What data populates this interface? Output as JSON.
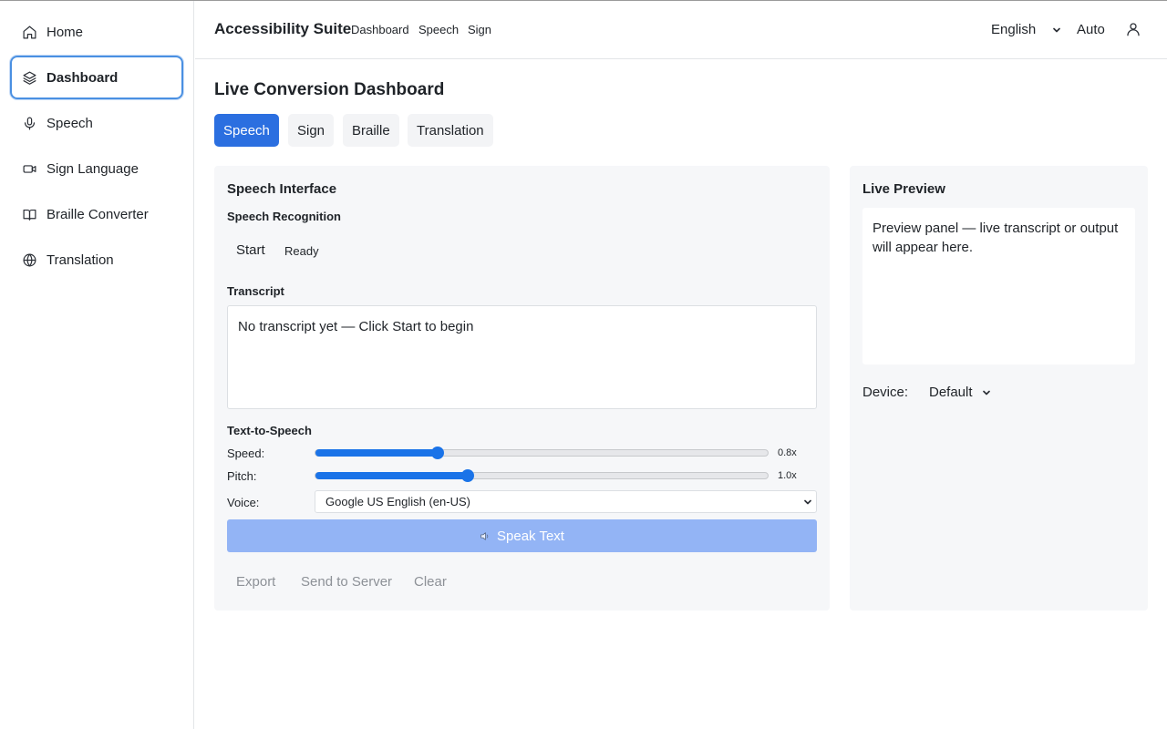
{
  "sidebar": {
    "items": [
      {
        "label": "Home",
        "icon": "home-icon"
      },
      {
        "label": "Dashboard",
        "icon": "layers-icon",
        "active": true
      },
      {
        "label": "Speech",
        "icon": "microphone-icon"
      },
      {
        "label": "Sign Language",
        "icon": "video-camera-icon"
      },
      {
        "label": "Braille Converter",
        "icon": "book-icon"
      },
      {
        "label": "Translation",
        "icon": "globe-icon"
      }
    ]
  },
  "header": {
    "brand": "Accessibility Suite",
    "nav": [
      "Dashboard",
      "Speech",
      "Sign"
    ],
    "language": "English",
    "mode": "Auto",
    "user_icon": "user-icon"
  },
  "main": {
    "title": "Live Conversion Dashboard",
    "tabs": [
      {
        "label": "Speech",
        "active": true
      },
      {
        "label": "Sign"
      },
      {
        "label": "Braille"
      },
      {
        "label": "Translation"
      }
    ],
    "speech_panel": {
      "title": "Speech Interface",
      "recognition_title": "Speech Recognition",
      "start_label": "Start",
      "status": "Ready",
      "transcript_title": "Transcript",
      "transcript_text": "No transcript yet — Click Start to begin",
      "tts_title": "Text-to-Speech",
      "speed_label": "Speed:",
      "speed_value": "0.8x",
      "speed_fraction": 0.27,
      "pitch_label": "Pitch:",
      "pitch_value": "1.0x",
      "pitch_fraction": 0.337,
      "voice_label": "Voice:",
      "voice_selected": "Google US English (en-US)",
      "speak_label": "Speak Text",
      "actions": [
        "Export",
        "Send to Server",
        "Clear"
      ]
    },
    "preview_panel": {
      "title": "Live Preview",
      "text": "Preview panel — live transcript or output will appear here.",
      "device_label": "Device:",
      "device_selected": "Default"
    }
  },
  "colors": {
    "accent": "#2b6fe0",
    "slider": "#1a73e8",
    "speak_button": "#93b4f5",
    "panel_bg": "#f6f7f9",
    "active_outline": "#4a90e2"
  }
}
